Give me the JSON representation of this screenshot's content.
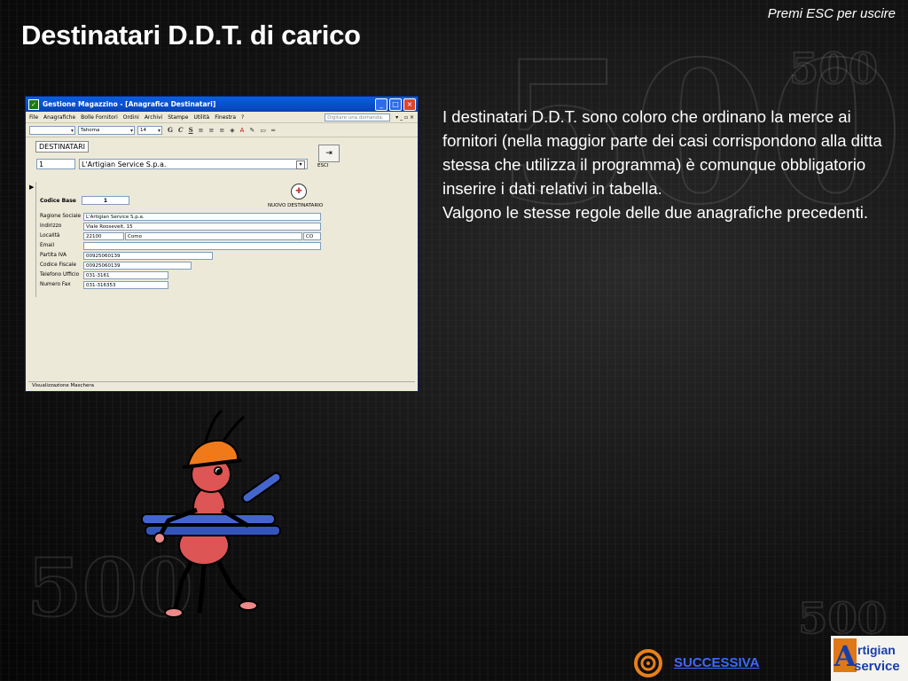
{
  "slide": {
    "title": "Destinatari D.D.T. di carico",
    "esc_hint": "Premi ESC per uscire",
    "body_paragraphs": [
      "I destinatari D.D.T. sono coloro che ordinano la merce ai fornitori (nella maggior parte dei casi corrispondono alla ditta stessa che utilizza il programma) è comunque obbligatorio inserire i dati relativi in tabella.",
      "Valgono le stesse regole delle due anagrafiche precedenti."
    ],
    "next_label": "SUCCESSIVA",
    "logo": {
      "letter": "A",
      "top": "rtigian",
      "bottom": "service"
    }
  },
  "window": {
    "title": "Gestione Magazzino - [Anagrafica Destinatari]",
    "menu": [
      "File",
      "Anagrafiche",
      "Bolle Fornitori",
      "Ordini",
      "Archivi",
      "Stampe",
      "Utilità",
      "Finestra",
      "?"
    ],
    "help_placeholder": "Digitare una domanda.",
    "toolbar": {
      "font": "Tahoma",
      "size": "14",
      "bold": "G",
      "italic": "C",
      "underline": "S"
    },
    "form": {
      "title": "DESTINATARI",
      "record_id": "1",
      "record_name": "L'Artigian Service S.p.a.",
      "esci_label": "ESCI",
      "new_label": "NUOVO DESTINATARIO",
      "codice_label": "Codice Base",
      "codice_value": "1",
      "fields": {
        "ragione_sociale": {
          "label": "Ragione Sociale",
          "value": "L'Artigian Service S.p.a."
        },
        "indirizzo": {
          "label": "Indirizzo",
          "value": "Viale Roosevelt, 15"
        },
        "localita": {
          "label": "Località",
          "cap": "22100",
          "city": "Como",
          "prov": "CO"
        },
        "email": {
          "label": "Email",
          "value": ""
        },
        "partita_iva": {
          "label": "Partita IVA",
          "value": "00925060139"
        },
        "codice_fiscale": {
          "label": "Codice Fiscale",
          "value": "00925060139"
        },
        "telefono": {
          "label": "Telefono Ufficio",
          "value": "031-3161"
        },
        "fax": {
          "label": "Numero Fax",
          "value": "031-316353"
        }
      }
    },
    "status": "Visualizzazione Maschera"
  }
}
